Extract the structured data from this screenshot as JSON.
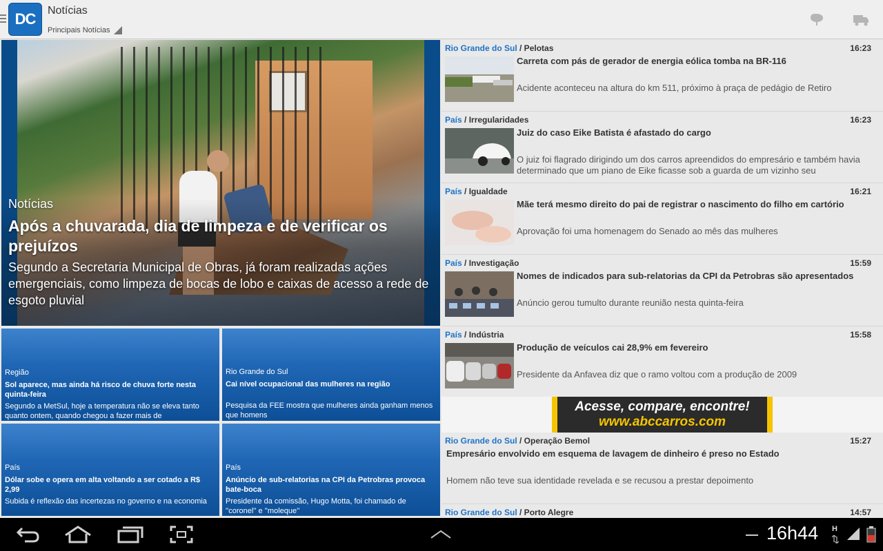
{
  "actionbar": {
    "logo": "DC",
    "title": "Notícias",
    "subtitle": "Principais Notícias",
    "icons": [
      "weather-icon",
      "traffic-truck-icon"
    ]
  },
  "featured": {
    "section": "Notícias",
    "title": "Após a chuvarada, dia de limpeza e de verificar os prejuízos",
    "description": "Segundo a Secretaria Municipal de Obras, já foram realizadas ações emergenciais, como limpeza de bocas de lobo e caixas de acesso a rede de esgoto pluvial"
  },
  "tiles": [
    {
      "section": "Região",
      "title": "Sol aparece, mas ainda há risco de chuva forte nesta quinta-feira",
      "description": "Segundo a MetSul, hoje a temperatura não se eleva tanto quanto ontem, quando chegou a fazer mais de"
    },
    {
      "section": "Rio Grande do Sul",
      "title": "Cai nível ocupacional das mulheres na região",
      "description": "Pesquisa da FEE mostra que mulheres ainda ganham menos que homens"
    },
    {
      "section": "País",
      "title": "Dólar sobe e opera em alta voltando a ser cotado a R$ 2,99",
      "description": "Subida é reflexão das incertezas no governo e na economia"
    },
    {
      "section": "País",
      "title": "Anúncio de sub-relatorias na CPI da Petrobras provoca bate-boca",
      "description": "Presidente da comissão, Hugo Motta, foi chamado de ''coronel'' e ''moleque''"
    }
  ],
  "news": [
    {
      "category": "Rio Grande do Sul",
      "subcategory": "/ Pelotas",
      "time": "16:23",
      "headline": "Carreta com pás de gerador de energia eólica tomba na BR-116",
      "description": "Acidente aconteceu na altura do km 511, próximo à praça de pedágio de Retiro"
    },
    {
      "category": "País",
      "subcategory": "/ Irregularidades",
      "time": "16:23",
      "headline": "Juiz do caso Eike Batista é afastado do cargo",
      "description": "O juiz foi flagrado dirigindo um dos carros apreendidos do empresário e também havia determinado que um piano de Eike ficasse sob a guarda de um vizinho seu"
    },
    {
      "category": "País",
      "subcategory": "/ Igualdade",
      "time": "16:21",
      "headline": "Mãe terá mesmo direito do pai de registrar o nascimento do filho em cartório",
      "description": "Aprovação foi uma homenagem do Senado ao mês das mulheres"
    },
    {
      "category": "País",
      "subcategory": "/ Investigação",
      "time": "15:59",
      "headline": "Nomes de indicados para sub-relatorias da CPI da Petrobras são apresentados",
      "description": "Anúncio gerou tumulto durante reunião nesta quinta-feira"
    },
    {
      "category": "País",
      "subcategory": "/ Indústria",
      "time": "15:58",
      "headline": "Produção de veículos cai 28,9% em fevereiro",
      "description": "Presidente da Anfavea diz que o ramo voltou com a produção de 2009"
    },
    {
      "category": "Rio Grande do Sul",
      "subcategory": "/ Operação Bemol",
      "time": "15:27",
      "headline": "Empresário envolvido em esquema de lavagem de dinheiro é preso no Estado",
      "description": "Homem não teve sua identidade revelada e se recusou a prestar depoimento"
    },
    {
      "category": "Rio Grande do Sul",
      "subcategory": "/ Porto Alegre",
      "time": "14:57",
      "headline": "",
      "description": ""
    }
  ],
  "ad": {
    "line1": "Acesse, compare, encontre!",
    "line2": "www.abccarros.com"
  },
  "systembar": {
    "clock": "16h44",
    "data_indicator": "H",
    "colors": {
      "background": "#000000",
      "accent": "#1e73c6"
    }
  }
}
